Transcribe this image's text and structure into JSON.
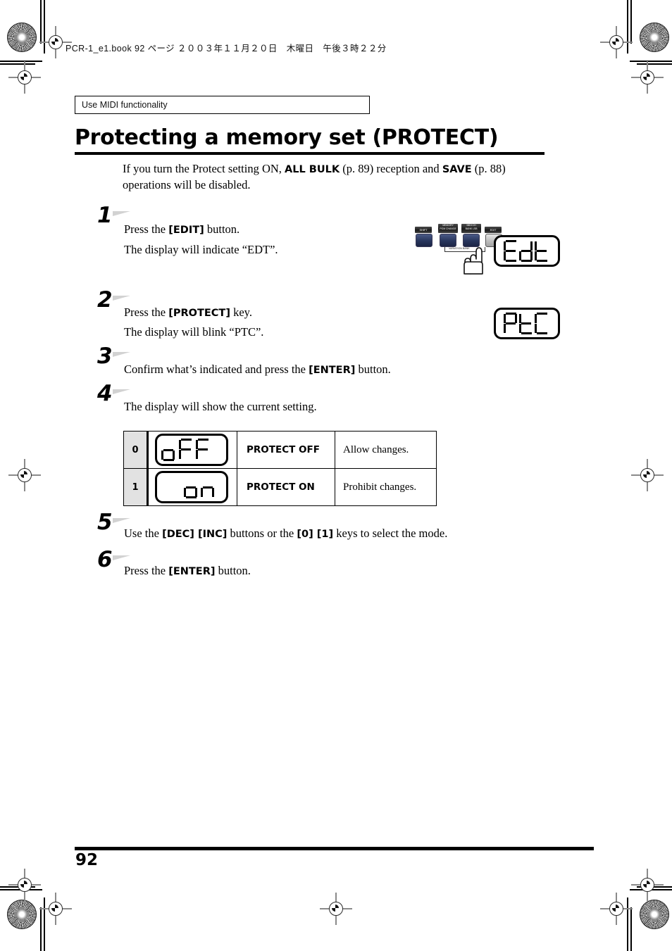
{
  "page": {
    "file_info": "PCR-1_e1.book  92 ページ  ２００３年１１月２０日　木曜日　午後３時２２分",
    "running_head": "Use MIDI functionality",
    "title": "Protecting a memory set (PROTECT)",
    "page_number": "92"
  },
  "intro": {
    "part1": "If you turn the Protect setting ON, ",
    "bold1": "ALL BULK",
    "part2": " (p. 89) reception and ",
    "bold2": "SAVE",
    "part3": " (p. 88) operations will be disabled."
  },
  "steps": [
    {
      "number": "1",
      "line1_pre": "Press the ",
      "line1_bold": "[EDIT]",
      "line1_post": " button.",
      "line2": "The display will indicate “EDT”."
    },
    {
      "number": "2",
      "line1_pre": "Press the ",
      "line1_bold": "[PROTECT]",
      "line1_post": " key.",
      "line2": "The display will blink “PTC”."
    },
    {
      "number": "3",
      "line1_pre": "Confirm what’s indicated and press the ",
      "line1_bold": "[ENTER]",
      "line1_post": " button."
    },
    {
      "number": "4",
      "line1_pre": "The display will show the current setting."
    },
    {
      "number": "5",
      "line1_pre": "Use the ",
      "line1_bold": "[DEC] [INC]",
      "line1_mid": " buttons or the ",
      "line1_bold2": "[0] [1]",
      "line1_post": " keys to select the mode."
    },
    {
      "number": "6",
      "line1_pre": "Press the ",
      "line1_bold": "[ENTER]",
      "line1_post": " button."
    }
  ],
  "displays": {
    "edit_display": "Edt",
    "protect_display": "PtC"
  },
  "device_illustration": {
    "buttons": [
      {
        "label": "SHIFT",
        "state": "blue"
      },
      {
        "label": "MEMORY\nPGM CHANGE",
        "state": "blue"
      },
      {
        "label": "MIDI CH\nBANK LSB",
        "state": "blue"
      },
      {
        "label": "EDIT",
        "state": "pressed"
      }
    ],
    "brace_label": "VARIATION      BANK"
  },
  "table": {
    "rows": [
      {
        "value": "0",
        "display": "oFF",
        "mode": "PROTECT OFF",
        "description": "Allow changes."
      },
      {
        "value": "1",
        "display": "on",
        "mode": "PROTECT ON",
        "description": "Prohibit changes."
      }
    ]
  },
  "colors": {
    "gray_cell": "#e2e2e2",
    "wedge_gray": "#d2d2d2",
    "button_blue": "#27345c"
  }
}
